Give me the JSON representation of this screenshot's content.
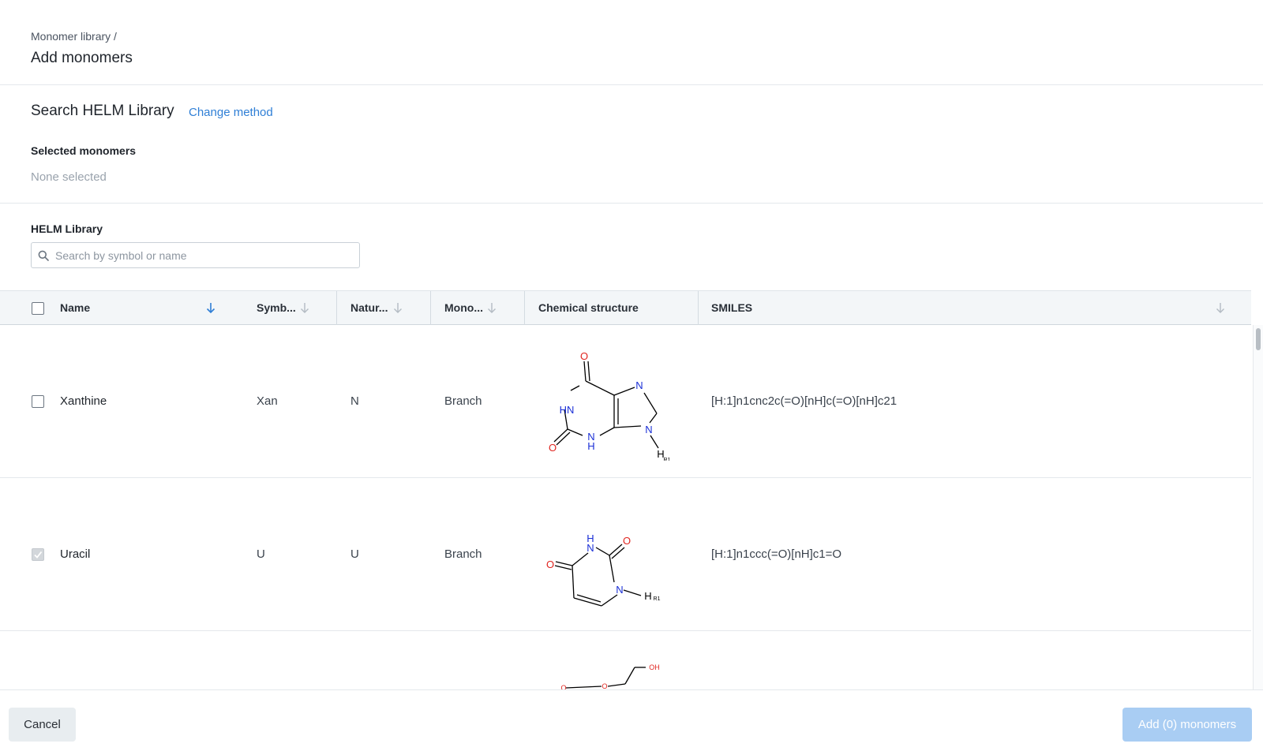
{
  "header": {
    "breadcrumb": "Monomer library /",
    "title": "Add monomers"
  },
  "method": {
    "title": "Search HELM Library",
    "change_link": "Change method",
    "selected_label": "Selected monomers",
    "selected_value": "None selected"
  },
  "library": {
    "label": "HELM Library",
    "search_placeholder": "Search by symbol or name"
  },
  "table": {
    "columns": {
      "name": "Name",
      "symbol": "Symb...",
      "natural": "Natur...",
      "monomer_type": "Mono...",
      "structure": "Chemical structure",
      "smiles": "SMILES"
    },
    "rows": [
      {
        "name": "Xanthine",
        "symbol": "Xan",
        "natural": "N",
        "monomer_type": "Branch",
        "smiles": "[H:1]n1cnc2c(=O)[nH]c(=O)[nH]c21",
        "checked": false
      },
      {
        "name": "Uracil",
        "symbol": "U",
        "natural": "U",
        "monomer_type": "Branch",
        "smiles": "[H:1]n1ccc(=O)[nH]c1=O",
        "checked": true
      }
    ],
    "structure_labels": {
      "oxygen": "O",
      "nitrogen": "N",
      "hydrogen": "H",
      "imine": "HN",
      "r1": "R1",
      "hydroxyl": "OH"
    }
  },
  "footer": {
    "cancel_label": "Cancel",
    "add_label": "Add (0) monomers"
  },
  "colors": {
    "accent": "#2f7fd6",
    "oxygen": "#e0241f",
    "nitrogen": "#1a2fd6",
    "primary_disabled": "#a9cdf3"
  }
}
